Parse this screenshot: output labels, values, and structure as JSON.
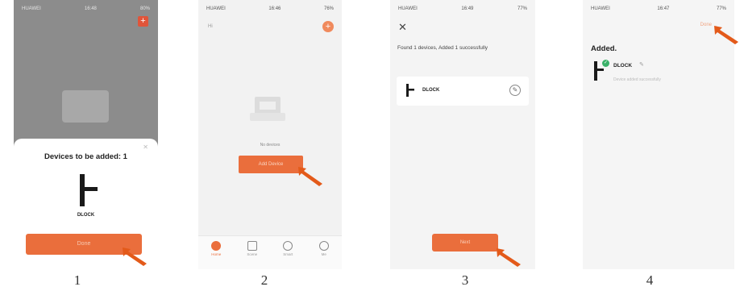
{
  "screens": [
    {
      "step": "1",
      "status": {
        "carrier": "HUAWEI",
        "time": "16:48",
        "battery": "80%"
      },
      "sheet_title": "Devices to be added: 1",
      "device_name": "DLOCK",
      "primary_button": "Done"
    },
    {
      "step": "2",
      "status": {
        "carrier": "HUAWEI",
        "time": "16:46",
        "battery": "76%"
      },
      "top_left": "Hi",
      "empty_text": "No devices",
      "primary_button": "Add Device",
      "tabs": [
        "Home",
        "Scene",
        "Smart",
        "Me"
      ]
    },
    {
      "step": "3",
      "status": {
        "carrier": "HUAWEI",
        "time": "16:49",
        "battery": "77%"
      },
      "message": "Found 1 devices, Added 1 successfully",
      "device_name": "DLOCK",
      "primary_button": "Next"
    },
    {
      "step": "4",
      "status": {
        "carrier": "HUAWEI",
        "time": "16:47",
        "battery": "77%"
      },
      "done_link": "Done",
      "heading": "Added.",
      "device_name": "DLOCK",
      "device_sub": "Device added successfully"
    }
  ],
  "colors": {
    "accent": "#ea6e3c",
    "arrow": "#e35a1a",
    "success": "#3bb26a"
  }
}
